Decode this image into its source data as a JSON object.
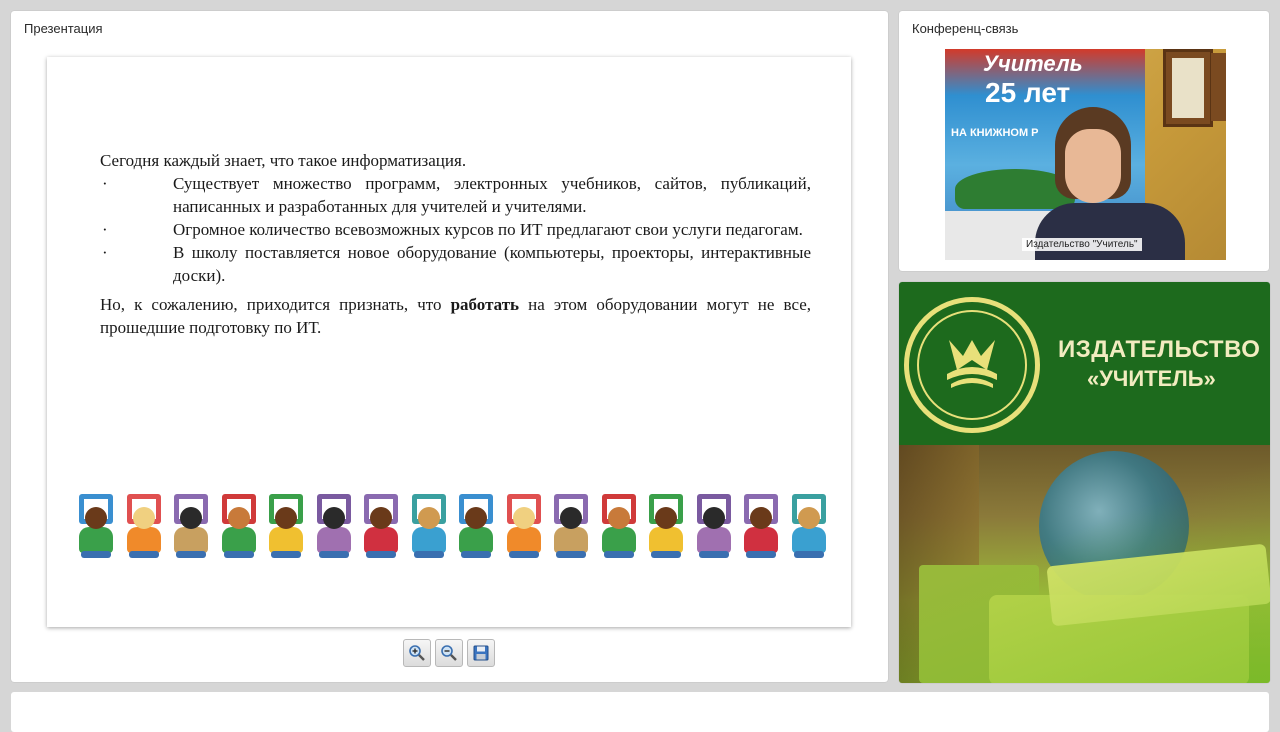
{
  "presentation": {
    "title": "Презентация",
    "slide": {
      "intro": "Сегодня каждый знает, что такое информатизация.",
      "bullets": [
        {
          "marker": "·",
          "text": "Существует множество программ, электронных учебников, сайтов, публикаций, написанных и разработанных для учителей и учителями."
        },
        {
          "marker": "·",
          "text": "Огромное количество всевозможных курсов по ИТ предлагают свои услуги педагогам."
        },
        {
          "marker": "·",
          "text": "В школу поставляется новое оборудование (компьютеры, проекторы, интерактивные доски)."
        }
      ],
      "closing_before": "Но, к сожалению, приходится признать, что ",
      "closing_bold": "работать",
      "closing_after": " на этом оборудовании могут не все, прошедшие подготовку по ИТ."
    },
    "toolbar": {
      "zoom_in_icon": "zoom-in-icon",
      "zoom_out_icon": "zoom-out-icon",
      "save_icon": "save-icon"
    }
  },
  "conference": {
    "title": "Конференц-связь",
    "video_caption": "Издательство \"Учитель\"",
    "poster_line1": "Учитель",
    "poster_line2": "25 лет",
    "poster_line3": "НА КНИЖНОМ Р"
  },
  "promo": {
    "brand_line1": "ИЗДАТЕЛЬСТВО",
    "brand_line2": "«УЧИТЕЛЬ»",
    "colors": {
      "green": "#1d6a1d",
      "gold": "#e8e07a"
    }
  }
}
